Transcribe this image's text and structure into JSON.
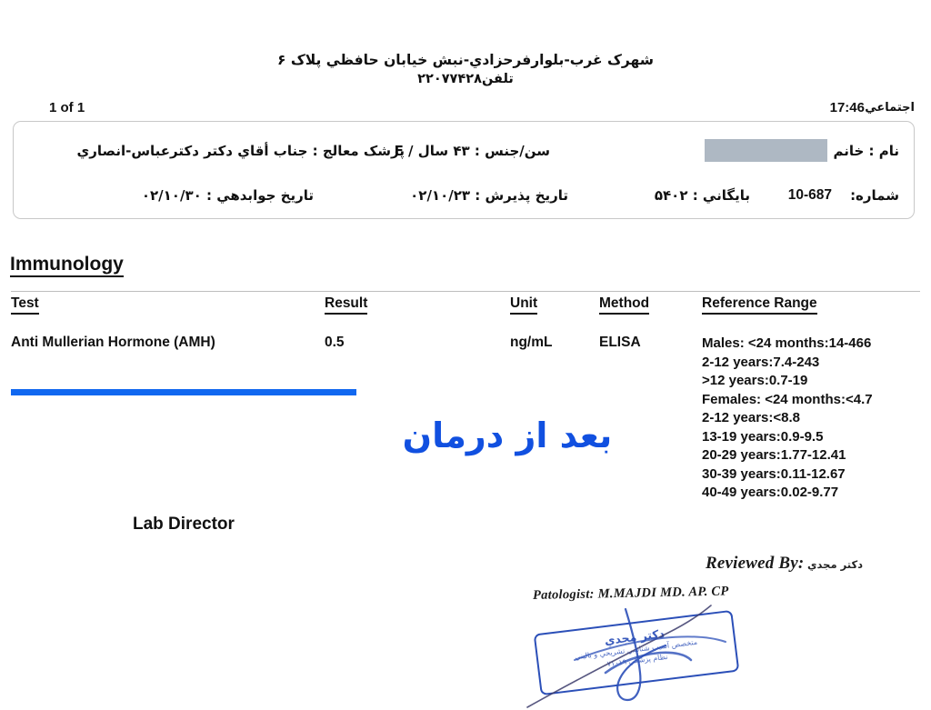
{
  "clinic": {
    "address": "شهرک غرب-بلوارفرحزادي-نبش خيابان حافظي پلاک ۶",
    "phone": "تلفن۲۲۰۷۷۴۲۸"
  },
  "meta": {
    "page_indicator": "1 of 1",
    "visit_time": "17:46",
    "insurance_type": "اجتماعي"
  },
  "patient": {
    "name_label": "نام : خانم",
    "name_value_redacted": "",
    "age_sex": "سن/جنس : ۴۳ سال / F",
    "doctor": "پزشک معالج : جناب أقاي دکتر  دکترعباس-انصاري",
    "record_label": "شماره:",
    "record_number": "10-687",
    "file_number": "بايگاني : ۵۴۰۲",
    "admission_date": "تاريخ پذيرش : ۰۲/۱۰/۲۳",
    "report_date": "تاريخ جوابدهي : ۰۲/۱۰/۳۰"
  },
  "report": {
    "section_title": "Immunology",
    "columns": [
      "Test",
      "Result",
      "Unit",
      "Method",
      "Reference Range"
    ],
    "rows": [
      {
        "test": "Anti Mullerian Hormone (AMH)",
        "result": "0.5",
        "unit": "ng/mL",
        "method": "ELISA",
        "highlighted": true
      }
    ],
    "reference_range_lines": [
      "Males:  <24 months:14-466",
      "2-12 years:7.4-243",
      ">12 years:0.7-19",
      "Females:   <24 months:<4.7",
      "2-12 years:<8.8",
      "13-19 years:0.9-9.5",
      "20-29 years:1.77-12.41",
      "30-39 years:0.11-12.67",
      "40-49 years:0.02-9.77"
    ]
  },
  "annotation": {
    "handwritten_note": "بعد از درمان",
    "note_color": "#1150e0"
  },
  "footer": {
    "lab_director": "Lab Director",
    "reviewed_by": "Reviewed By:",
    "reviewer_name_fa": "دکتر مجدي",
    "pathologist": "Patologist: M.MAJDI MD. AP. CP"
  },
  "stamp": {
    "line1": "دکتر مجدي",
    "line2": "متخصص آسيب شناسي تشريحي و باليني",
    "line3": "نظام پزشکي ۷۱۰۱۹",
    "color": "#2b4fb8"
  },
  "colors": {
    "highlight_bar": "#1168f0",
    "redaction": "#aeb8c3",
    "card_border": "#c8c8c8"
  }
}
